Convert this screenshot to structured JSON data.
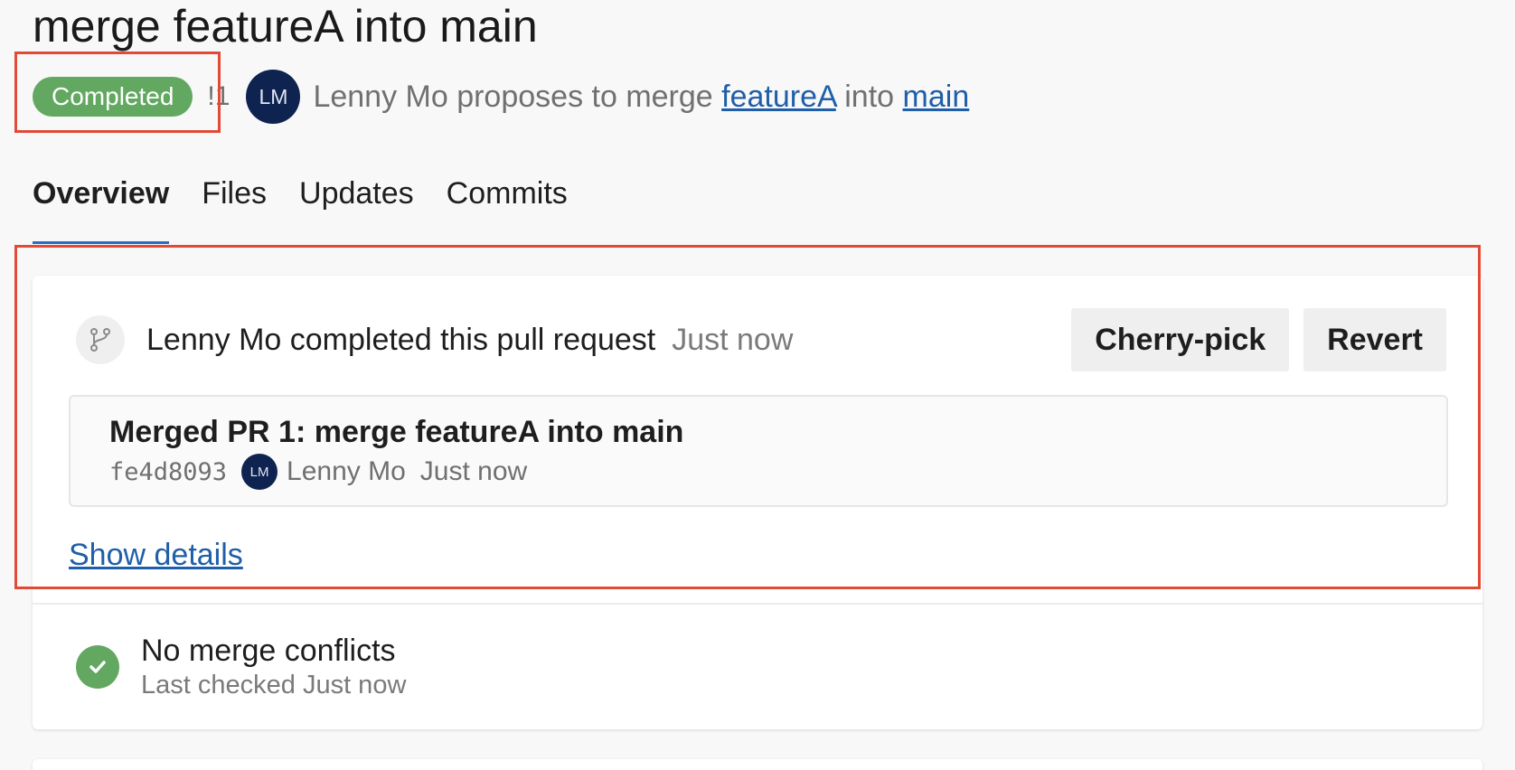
{
  "pr": {
    "title": "merge featureA into main",
    "status": "Completed",
    "id": "!1",
    "author_initials": "LM",
    "proposal_prefix": "Lenny Mo proposes to merge",
    "source_branch": "featureA",
    "into_word": "into",
    "target_branch": "main"
  },
  "tabs": [
    {
      "label": "Overview",
      "active": true
    },
    {
      "label": "Files"
    },
    {
      "label": "Updates"
    },
    {
      "label": "Commits"
    }
  ],
  "timeline": {
    "event_text": "Lenny Mo completed this pull request",
    "event_time": "Just now",
    "icon": "branch-merge-icon",
    "cherry_pick_label": "Cherry-pick",
    "revert_label": "Revert"
  },
  "merge_commit": {
    "title": "Merged PR 1: merge featureA into main",
    "hash": "fe4d8093",
    "author_initials": "LM",
    "author": "Lenny Mo",
    "time": "Just now"
  },
  "show_details_label": "Show details",
  "conflicts": {
    "icon": "check-circle-icon",
    "title": "No merge conflicts",
    "subtitle": "Last checked Just now"
  },
  "colors": {
    "status_green": "#62a861",
    "link_blue": "#1f5ea8",
    "avatar_navy": "#0f2350",
    "highlight_red": "#e24a35"
  }
}
